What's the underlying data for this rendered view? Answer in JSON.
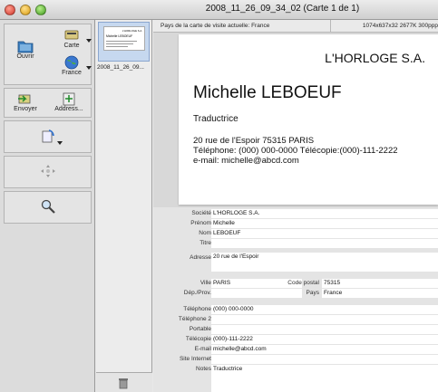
{
  "window": {
    "title": "2008_11_26_09_34_02 (Carte 1 de 1)"
  },
  "toolbar": {
    "open_label": "Ouvrir",
    "card_label": "Carte",
    "country_label": "France",
    "send_label": "Envoyer",
    "address_label": "Address..."
  },
  "thumbnails": [
    {
      "label": "2008_11_26_09..."
    }
  ],
  "thumb_card": {
    "company": "L'HORLOGE S.A.",
    "name": "Michelle LEBOEUF"
  },
  "infobar": {
    "country_text": "Pays de la carte de visite actuelle: France",
    "image_info": "1074x637x32  2677K  300ppp"
  },
  "card": {
    "company": "L'HORLOGE S.A.",
    "name": "Michelle LEBOEUF",
    "title": "Traductrice",
    "address_line": "20 rue de l'Espoir 75315 PARIS",
    "phone_line": "Téléphone: (000) 000-0000   Télécopie:(000)-111-2222",
    "email_line": "e-mail: michelle@abcd.com"
  },
  "form": {
    "labels": {
      "societe": "Société",
      "prenom": "Prénom",
      "nom": "Nom",
      "titre": "Titre",
      "adresse": "Adresse",
      "ville": "Ville",
      "code_postal": "Code postal",
      "dep_prov": "Dép./Prov.",
      "pays": "Pays",
      "telephone": "Téléphone",
      "telephone2": "Téléphone 2",
      "portable": "Portable",
      "telecopie": "Télécopie",
      "email": "E-mail",
      "site": "Site Internet",
      "notes": "Notes"
    },
    "values": {
      "societe": "L'HORLOGE S.A.",
      "prenom": "Michelle",
      "nom": "LEBOEUF",
      "titre": "",
      "adresse": "20 rue de l'Espoir",
      "ville": "PARIS",
      "code_postal": "75315",
      "dep_prov": "",
      "pays": "France",
      "telephone": "(000) 000-0000",
      "telephone2": "",
      "portable": "",
      "telecopie": "(000)-111-2222",
      "email": "michelle@abcd.com",
      "site": "",
      "notes": "Traductrice"
    }
  },
  "colors": {
    "selection": "#c6d8ef",
    "window_bg": "#e8e8e8"
  }
}
